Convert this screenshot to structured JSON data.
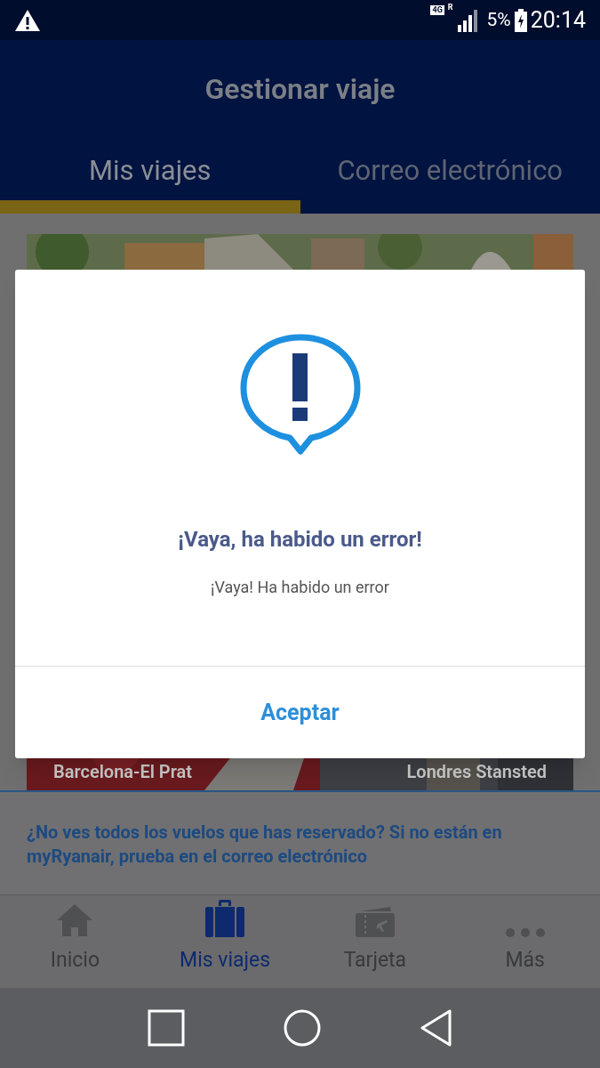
{
  "status_bar": {
    "network": "4G",
    "roaming": "R",
    "battery": "5%",
    "time": "20:14"
  },
  "header": {
    "title": "Gestionar viaje"
  },
  "tabs": [
    {
      "label": "Mis viajes",
      "selected": true
    },
    {
      "label": "Correo electrónico",
      "selected": false
    }
  ],
  "trips": [
    {
      "kind": "picture"
    },
    {
      "kind": "route",
      "origin": "Barcelona-El Prat",
      "destination": "Londres Stansted"
    }
  ],
  "info_text": "¿No ves todos los vuelos que has reservado? Si no están en myRyanair, prueba en el correo electrónico",
  "bottom_nav": [
    {
      "label": "Inicio",
      "selected": false
    },
    {
      "label": "Mis viajes",
      "selected": true
    },
    {
      "label": "Tarjeta",
      "selected": false
    },
    {
      "label": "Más",
      "selected": false
    }
  ],
  "dialog": {
    "title": "¡Vaya, ha habido un error!",
    "message": "¡Vaya! Ha habido un error",
    "button": "Aceptar"
  }
}
